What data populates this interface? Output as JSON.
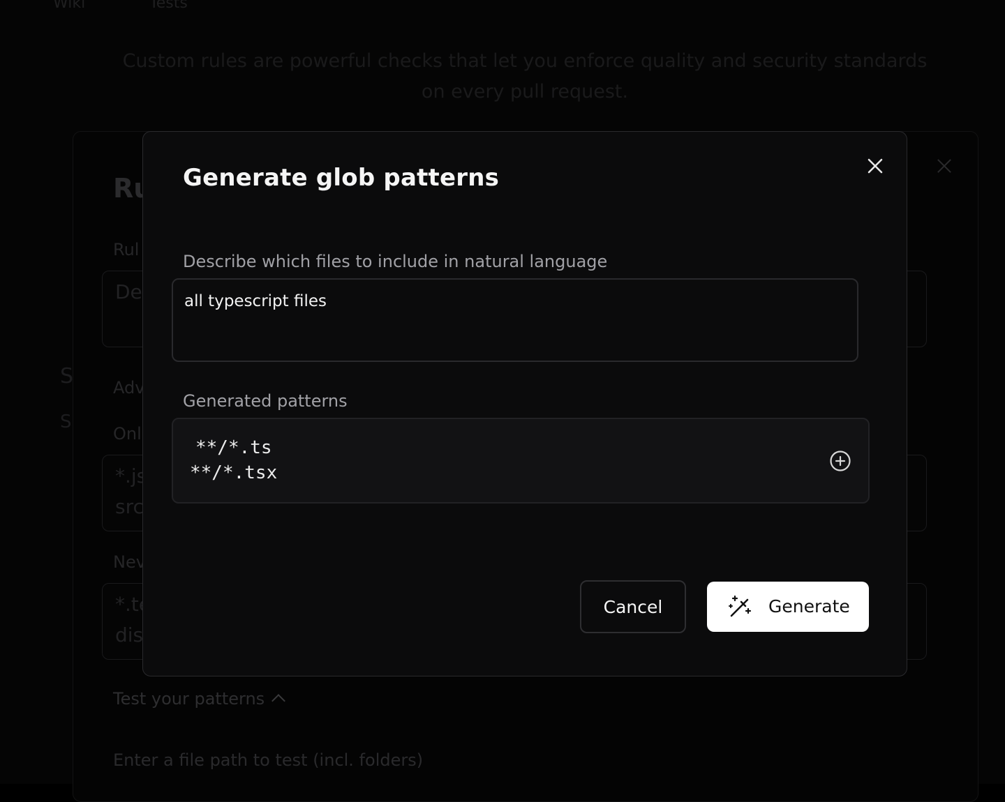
{
  "background": {
    "tabs": [
      "Wiki",
      "Tests"
    ],
    "subtitle_line1": "Custom rules are powerful checks that let you enforce quality and security standards",
    "subtitle_line2": "on every pull request.",
    "panel_title_fragment": "Ru",
    "label_fragment_rule": "Rul",
    "input_fragment_desc": "De",
    "side_letter_1": "S",
    "side_letter_2": "S",
    "label_fragment_adv": "Adv",
    "label_fragment_only": "Onl",
    "only_box_line1": "*.js",
    "only_box_line2": "src",
    "label_fragment_never": "Nev",
    "never_box_line1": "*.te",
    "never_box_line2": "dis",
    "test_patterns_label": "Test your patterns",
    "test_path_placeholder": "Enter a file path to test (incl. folders)"
  },
  "modal": {
    "title": "Generate glob patterns",
    "description_label": "Describe which files to include in natural language",
    "description_value": "all typescript files",
    "generated_label": "Generated patterns",
    "patterns": [
      "**/*.ts",
      "**/*.tsx"
    ],
    "cancel_label": "Cancel",
    "generate_label": "Generate"
  },
  "icons": {
    "close": "close-icon",
    "add": "plus-circle-icon",
    "wand": "magic-wand-icon",
    "chevron": "chevron-up-icon"
  },
  "colors": {
    "modal_bg": "#0b0b0c",
    "border": "#2a2a2d",
    "primary_button_bg": "#ffffff",
    "text_primary": "#f5f5f5",
    "text_muted": "#a1a1a6"
  }
}
